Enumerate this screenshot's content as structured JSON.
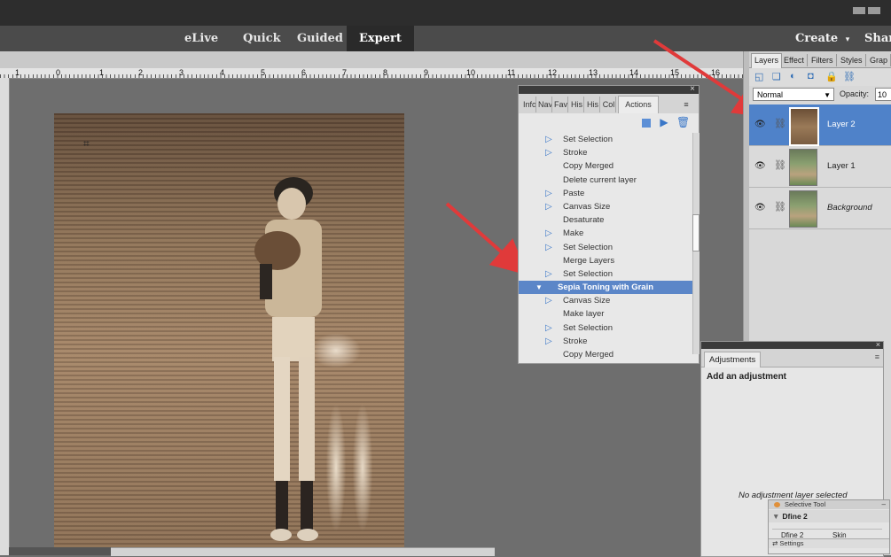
{
  "mode_bar": {
    "items": [
      "eLive",
      "Quick",
      "Guided",
      "Expert"
    ],
    "active": "Expert",
    "create_label": "Create",
    "share_label": "Shar"
  },
  "ruler": {
    "labels": [
      "1",
      "0",
      "1",
      "2",
      "3",
      "4",
      "5",
      "6",
      "7",
      "8",
      "9",
      "10",
      "11",
      "12",
      "13",
      "14",
      "15",
      "16"
    ]
  },
  "actions_panel": {
    "tabs": [
      "Info",
      "Nav",
      "Fav",
      "His",
      "His",
      "Col",
      "Actions"
    ],
    "active_tab": "Actions",
    "menu_icon": "panel-menu-icon",
    "items": [
      {
        "label": "Set Selection",
        "expandable": true
      },
      {
        "label": "Stroke",
        "expandable": true
      },
      {
        "label": "Copy Merged",
        "expandable": false
      },
      {
        "label": "Delete current layer",
        "expandable": false
      },
      {
        "label": "Paste",
        "expandable": true
      },
      {
        "label": "Canvas Size",
        "expandable": true
      },
      {
        "label": "Desaturate",
        "expandable": false
      },
      {
        "label": "Make",
        "expandable": true
      },
      {
        "label": "Set Selection",
        "expandable": true
      },
      {
        "label": "Merge Layers",
        "expandable": false
      },
      {
        "label": "Set Selection",
        "expandable": true
      },
      {
        "label": "Sepia Toning with Grain",
        "group": true
      },
      {
        "label": "Canvas Size",
        "expandable": true
      },
      {
        "label": "Make layer",
        "expandable": false
      },
      {
        "label": "Set Selection",
        "expandable": true
      },
      {
        "label": "Stroke",
        "expandable": true
      },
      {
        "label": "Copy Merged",
        "expandable": false
      }
    ]
  },
  "layers_panel": {
    "tabs": [
      "Layers",
      "Effect",
      "Filters",
      "Styles",
      "Grap"
    ],
    "active_tab": "Layers",
    "blend_mode": "Normal",
    "opacity_label": "Opacity:",
    "opacity_value": "10",
    "layers": [
      {
        "name": "Layer 2",
        "selected": true,
        "italic": false
      },
      {
        "name": "Layer 1",
        "selected": false,
        "italic": false
      },
      {
        "name": "Background",
        "selected": false,
        "italic": true
      }
    ]
  },
  "adjustments_panel": {
    "tab": "Adjustments",
    "title": "Add an adjustment",
    "empty_text": "No adjustment layer selected"
  },
  "selective_tool": {
    "title": "Selective Tool",
    "group": "Dfine 2",
    "row_left": "Dfine 2",
    "row_right": "Skin",
    "footer": "Settings"
  },
  "colors": {
    "accent": "#5b86c8",
    "arrow": "#e03a3a",
    "panel_bg": "#e8e8e8",
    "workspace": "#6e6e6e"
  }
}
